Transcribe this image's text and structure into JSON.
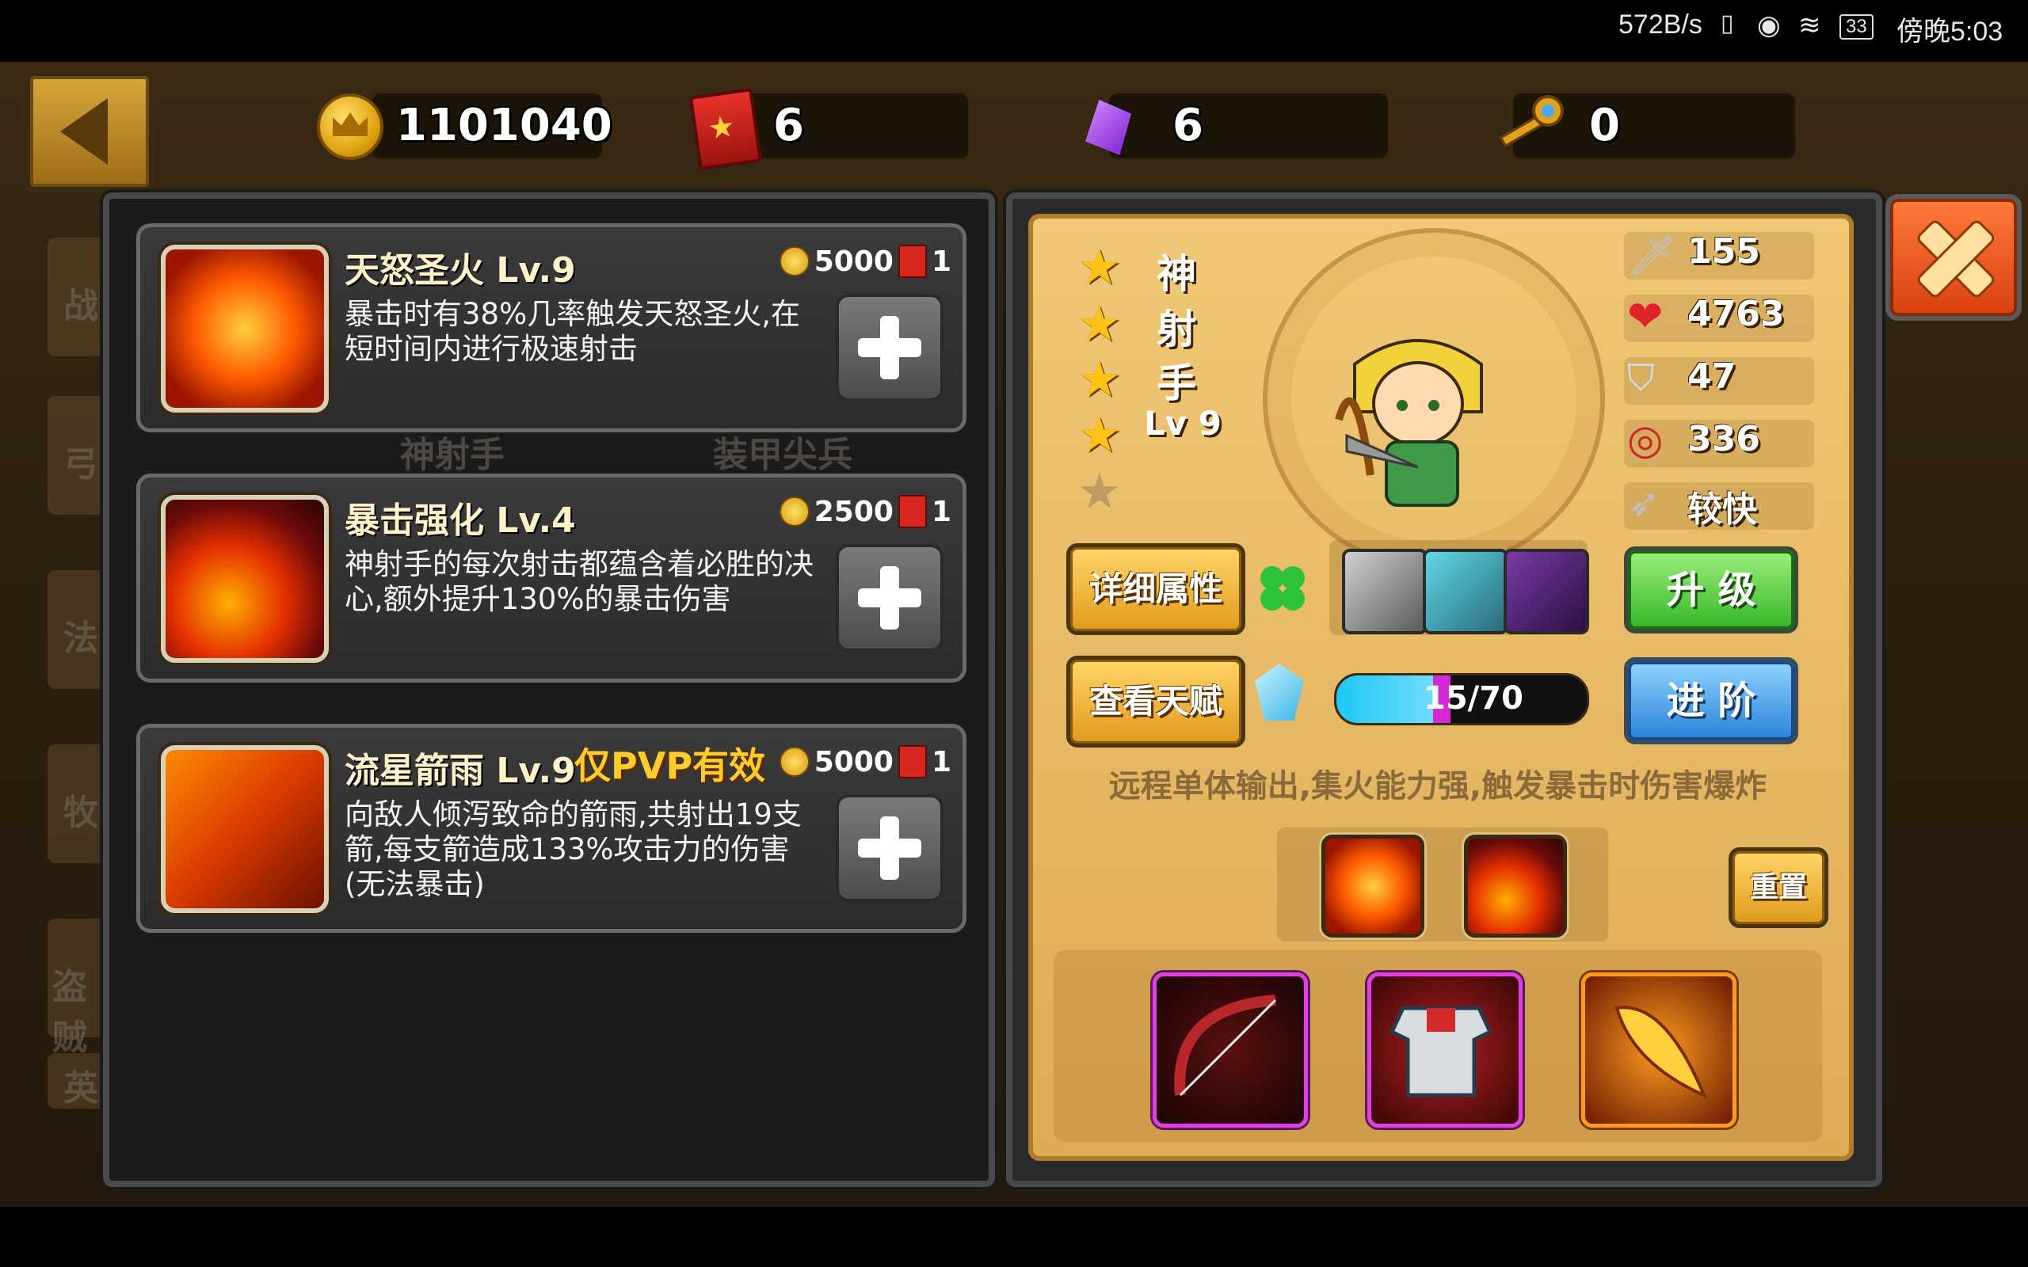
{
  "status_bar": {
    "net_speed": "572B/s",
    "battery": "33",
    "time": "傍晚5:03"
  },
  "currency": {
    "gold": "1101040",
    "skill_books": "6",
    "gems": "6",
    "keys": "0"
  },
  "background": {
    "hero_names": [
      "神射手",
      "装甲尖兵"
    ],
    "side_tabs": [
      "战",
      "弓",
      "法",
      "牧",
      "盗贼",
      "英"
    ]
  },
  "skills": [
    {
      "title": "天怒圣火 Lv.9",
      "desc": "暴击时有38%几率触发天怒圣火,在短时间内进行极速射击",
      "gold_cost": "5000",
      "book_cost": "1",
      "pvp_note": ""
    },
    {
      "title": "暴击强化 Lv.4",
      "desc": "神射手的每次射击都蕴含着必胜的决心,额外提升130%的暴击伤害",
      "gold_cost": "2500",
      "book_cost": "1",
      "pvp_note": ""
    },
    {
      "title": "流星箭雨 Lv.9",
      "desc": "向敌人倾泻致命的箭雨,共射出19支箭,每支箭造成133%攻击力的伤害(无法暴击)",
      "gold_cost": "5000",
      "book_cost": "1",
      "pvp_note": "仅PVP有效"
    }
  ],
  "hero": {
    "name_chars": [
      "神",
      "射",
      "手"
    ],
    "level": "Lv 9",
    "stars_filled": 4,
    "stars_total": 5,
    "stats": {
      "attack": "155",
      "hp": "4763",
      "defense": "47",
      "accuracy": "336",
      "attack_speed": "较快"
    },
    "exp_current": 15,
    "exp_max": 70,
    "exp_text": "15/70",
    "description": "远程单体输出,集火能力强,触发暴击时伤害爆炸"
  },
  "buttons": {
    "detail": "详细属性",
    "talent": "查看天赋",
    "upgrade": "升 级",
    "advance": "进 阶",
    "reset": "重置"
  },
  "colors": {
    "accent_gold": "#ffc316",
    "upgrade_green": "#36b529",
    "advance_blue": "#2a7fd8",
    "close_orange": "#e85a1a"
  }
}
